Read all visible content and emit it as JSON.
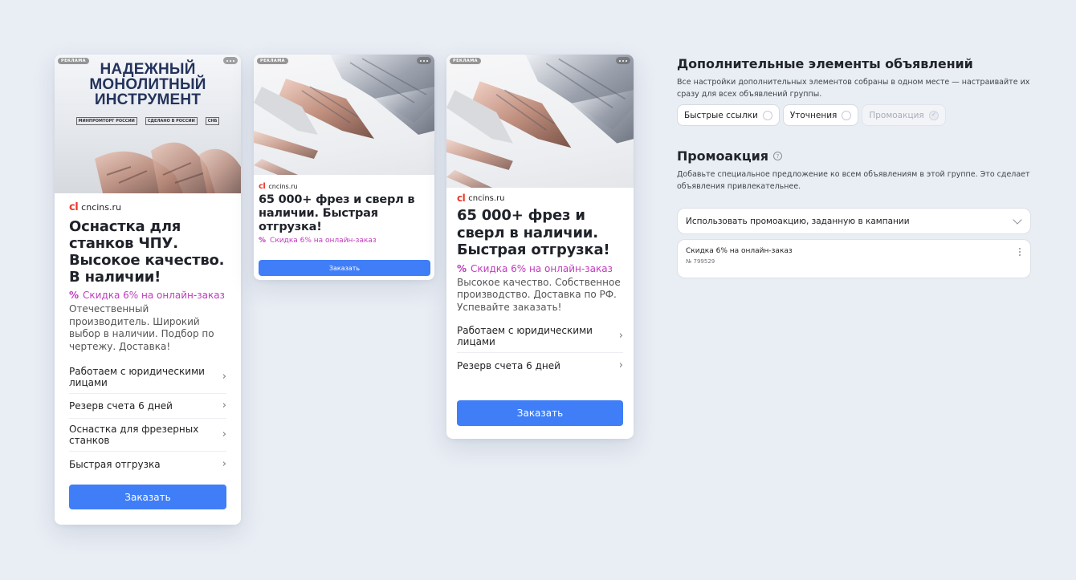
{
  "ad_label": "РЕКЛАМА",
  "card1": {
    "hero_title_lines": [
      "НАДЕЖНЫЙ",
      "МОНОЛИТНЫЙ",
      "ИНСТРУМЕНТ"
    ],
    "logos": [
      "МИНПРОМТОРГ РОССИИ",
      "СДЕЛАНО В РОССИИ",
      "СНБ"
    ],
    "domain": "cncins.ru",
    "title": "Оснастка для станков ЧПУ. Высокое качество. В наличии!",
    "promo": "Скидка 6% на онлайн-заказ",
    "description": "Отечественный производитель. Широкий выбор в наличии. Подбор по чертежу. Доставка!",
    "links": [
      "Работаем с юридическими лицами",
      "Резерв счета 6 дней",
      "Оснастка для фрезерных станков",
      "Быстрая отгрузка"
    ],
    "button": "Заказать"
  },
  "card2": {
    "domain": "cncins.ru",
    "title": "65 000+ фрез и сверл в наличии. Быстрая отгрузка!",
    "promo": "Скидка 6% на онлайн-заказ",
    "button": "Заказать"
  },
  "card3": {
    "domain": "cncins.ru",
    "title": "65 000+ фрез и сверл в наличии. Быстрая отгрузка!",
    "promo": "Скидка 6% на онлайн-заказ",
    "description": "Высокое качество. Собственное производство. Доставка по РФ. Успевайте заказать!",
    "links": [
      "Работаем с юридическими лицами",
      "Резерв счета 6 дней"
    ],
    "button": "Заказать"
  },
  "brand_mark": "cl",
  "promo_symbol": "%",
  "panel": {
    "extras_title": "Дополнительные элементы объявлений",
    "extras_sub": "Все настройки дополнительных элементов собраны в одном месте — настраивайте их сразу для всех объявлений группы.",
    "chips": [
      {
        "label": "Быстрые ссылки",
        "checked": false,
        "disabled": false
      },
      {
        "label": "Уточнения",
        "checked": false,
        "disabled": false
      },
      {
        "label": "Промоакция",
        "checked": true,
        "disabled": true
      }
    ],
    "promo_title": "Промоакция",
    "promo_sub": "Добавьте специальное предложение ко всем объявлениям в этой группе. Это сделает объявления привлекательнее.",
    "select_value": "Использовать промоакцию, заданную в кампании",
    "promo_item": {
      "title": "Скидка 6% на онлайн-заказ",
      "number": "№ 799529"
    }
  },
  "colors": {
    "background": "#e9edf4",
    "button": "#3f7ef7",
    "promo": "#c13bbd",
    "hero_title": "#24335c",
    "brand": "#e8392d"
  }
}
